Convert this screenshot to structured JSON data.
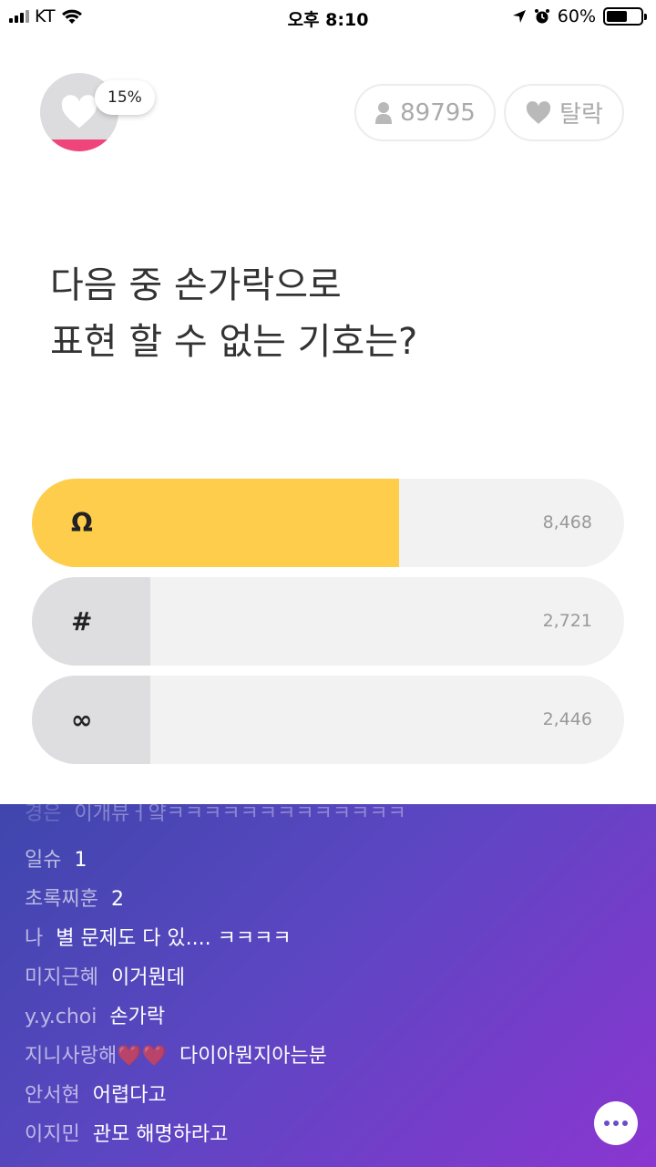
{
  "status_bar": {
    "carrier": "KT",
    "time": "오후 8:10",
    "battery": "60%",
    "battery_level": 0.6
  },
  "header": {
    "heart_percent": "15%",
    "heart_fill": 0.15,
    "participants": "89795",
    "leave_label": "탈락",
    "heart_color": "#f0457a"
  },
  "question": {
    "line1": "다음 중 손가락으로",
    "line2": "표현 할 수 없는 기호는?"
  },
  "answers": [
    {
      "symbol": "Ω",
      "count": "8,468",
      "bar_fraction": 0.62,
      "bar_color": "#fdcd4b"
    },
    {
      "symbol": "#",
      "count": "2,721",
      "bar_fraction": 0.2,
      "bar_color": "#dedee0"
    },
    {
      "symbol": "∞",
      "count": "2,446",
      "bar_fraction": 0.2,
      "bar_color": "#dedee0"
    }
  ],
  "chat": {
    "messages": [
      {
        "user": "경은",
        "text": "이개뷰ㅓ얔ㅋㅋㅋㅋㅋㅋㅋㅋㅋㅋㅋㅋㅋ"
      },
      {
        "user": "일슈",
        "text": "1"
      },
      {
        "user": "초록찌훈",
        "text": "2"
      },
      {
        "user": "나",
        "text": "별 문제도 다 있.... ㅋㅋㅋㅋ"
      },
      {
        "user": "미지근혜",
        "text": "이거뭔데"
      },
      {
        "user": "y.y.choi",
        "text": "손가락"
      },
      {
        "user": "지니사랑해❤️❤️",
        "text": "다이아뭔지아는분"
      },
      {
        "user": "안서현",
        "text": "어렵다고"
      },
      {
        "user": "이지민",
        "text": "관모 해명하라고"
      }
    ]
  },
  "icons": {
    "heart": "heart-icon",
    "person": "person-icon",
    "chat": "chat-bubble-icon"
  }
}
